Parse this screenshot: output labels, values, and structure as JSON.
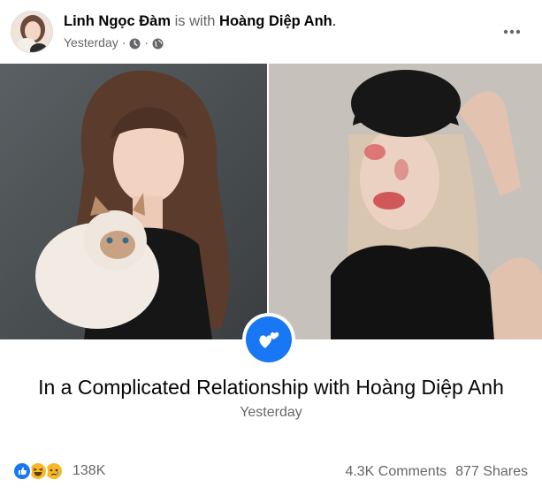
{
  "post": {
    "author": "Linh Ngọc Đàm",
    "with_text": "is with",
    "tagged": "Hoàng Diệp Anh",
    "period": ".",
    "time": "Yesterday",
    "dot": "·",
    "privacy_icon": "globe-icon",
    "timestamp_icon": "clock-icon"
  },
  "event": {
    "title": "In a Complicated Relationship with Hoàng Diệp Anh",
    "date": "Yesterday",
    "badge_icon": "broken-hearts-icon"
  },
  "footer": {
    "reactions": [
      "like-icon",
      "haha-icon",
      "sad-icon"
    ],
    "reaction_count": "138K",
    "comments": "4.3K Comments",
    "shares": "877 Shares"
  },
  "colors": {
    "accent": "#1877f2",
    "secondary_text": "#65676b",
    "primary_text": "#050505"
  }
}
